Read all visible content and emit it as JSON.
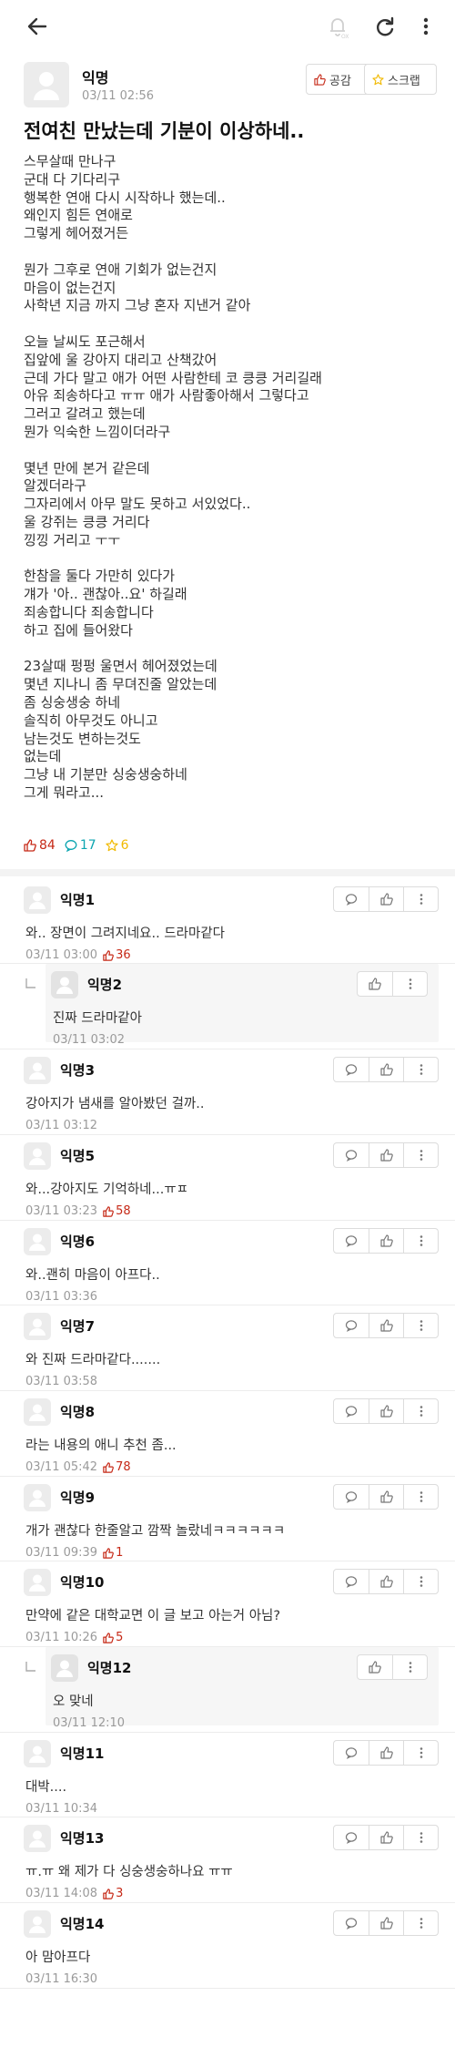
{
  "toolbar": {
    "back_icon": "back-arrow-icon",
    "notify_icon": "bell-off-icon",
    "refresh_icon": "refresh-icon",
    "more_icon": "more-vertical-icon"
  },
  "post": {
    "author": "익명",
    "time": "03/11 02:56",
    "like_button": "공감",
    "scrap_button": "스크랩",
    "title": "전여친 만났는데 기분이 이상하네..",
    "paragraphs": [
      [
        "스무살때 만나구",
        "군대 다 기다리구",
        "행복한 연애 다시 시작하나 했는데..",
        "왜인지 힘든 연애로",
        "그렇게 헤어졌거든"
      ],
      [
        "뭔가 그후로 연애 기회가 없는건지",
        "마음이 없는건지",
        "사학년 지금 까지 그냥 혼자 지낸거 같아"
      ],
      [
        "오늘 날씨도 포근해서",
        "집앞에 울 강아지 대리고 산책갔어",
        "근데 가다 말고 애가 어떤 사람한테 코 킁킁 거리길래",
        "아유 죄송하다고 ㅠㅠ 애가 사람좋아해서 그렇다고",
        "그러고 갈려고 했는데",
        "뭔가 익숙한 느낌이더라구"
      ],
      [
        "몇년 만에 본거 같은데",
        "알겠더라구",
        "그자리에서 아무 말도 못하고 서있었다..",
        "울 강쥐는 킁킁 거리다",
        "낑낑 거리고 ㅜㅜ"
      ],
      [
        "한참을 둘다 가만히 있다가",
        "걔가 '아.. 괜찮아..요' 하길래",
        "죄송합니다 죄송합니다",
        "하고 집에 들어왔다"
      ],
      [
        "23살때 펑펑 울면서 헤어졌었는데",
        "몇년 지나니 좀 무뎌진줄 알았는데",
        "좀 싱숭생숭 하네",
        "솔직히 아무것도 아니고",
        "남는것도 변하는것도",
        "없는데",
        "그냥 내 기분만 싱숭생숭하네",
        "그게 뭐라고..."
      ]
    ],
    "votes": "84",
    "comments": "17",
    "scraps": "6"
  },
  "comments": [
    {
      "author": "익명1",
      "text": "와.. 장면이 그려지네요.. 드라마같다",
      "time": "03/11 03:00",
      "votes": "36"
    },
    {
      "author": "익명2",
      "text": "진짜 드라마같아",
      "time": "03/11 03:02",
      "votes": null,
      "reply": true
    },
    {
      "author": "익명3",
      "text": "강아지가 냄새를 알아봤던 걸까..",
      "time": "03/11 03:12",
      "votes": null
    },
    {
      "author": "익명5",
      "text": "와...강아지도 기억하네...ㅠㅍ",
      "time": "03/11 03:23",
      "votes": "58"
    },
    {
      "author": "익명6",
      "text": "와..괜히 마음이 아프다..",
      "time": "03/11 03:36",
      "votes": null
    },
    {
      "author": "익명7",
      "text": "와 진짜 드라마같다.......",
      "time": "03/11 03:58",
      "votes": null
    },
    {
      "author": "익명8",
      "text": "라는 내용의 애니 추천 좀...",
      "time": "03/11 05:42",
      "votes": "78"
    },
    {
      "author": "익명9",
      "text": "개가 괜찮다 한줄알고 깜짝 놀랐네ㅋㅋㅋㅋㅋㅋ",
      "time": "03/11 09:39",
      "votes": "1"
    },
    {
      "author": "익명10",
      "text": "만약에 같은 대학교면 이 글 보고 아는거 아님?",
      "time": "03/11 10:26",
      "votes": "5"
    },
    {
      "author": "익명12",
      "text": "오 맞네",
      "time": "03/11 12:10",
      "votes": null,
      "reply": true
    },
    {
      "author": "익명11",
      "text": "대박....",
      "time": "03/11 10:34",
      "votes": null
    },
    {
      "author": "익명13",
      "text": "ㅠ.ㅠ 왜 제가 다 싱숭생숭하나요 ㅠㅠ",
      "time": "03/11 14:08",
      "votes": "3"
    },
    {
      "author": "익명14",
      "text": "아 맘아프다",
      "time": "03/11 16:30",
      "votes": null
    }
  ]
}
